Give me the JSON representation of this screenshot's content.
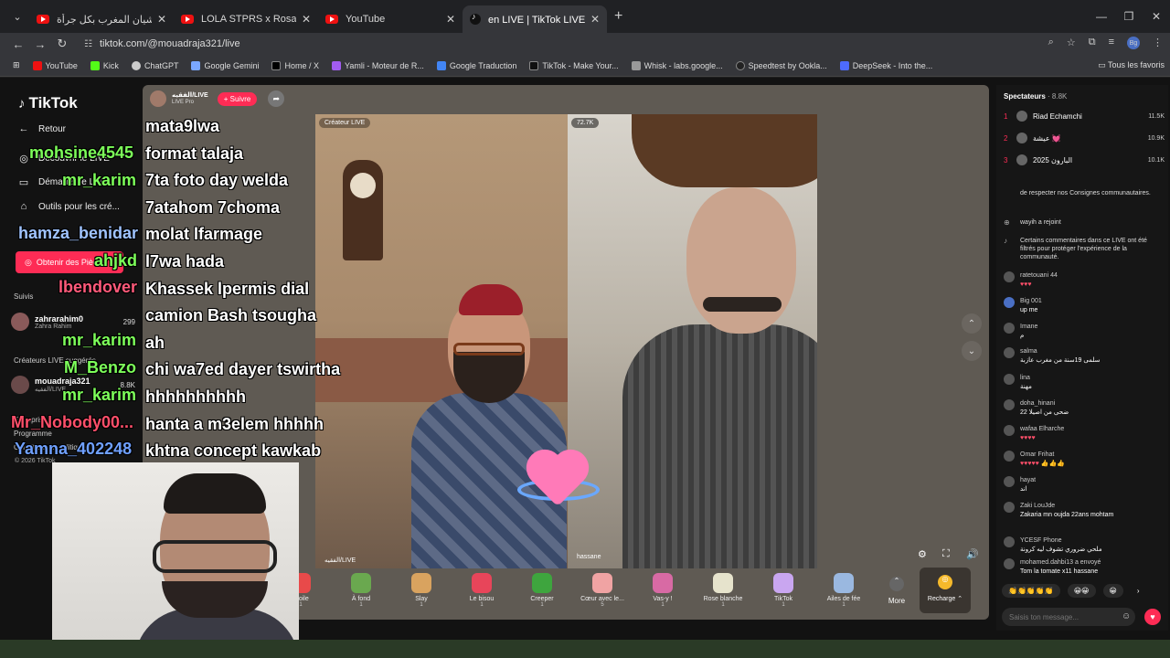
{
  "browser": {
    "tabs": [
      {
        "title": "كيم كارديشيان المغرب بكل جرأة...",
        "icon": "youtube-icon"
      },
      {
        "title": "LOLA STPRS x Rosalia BAGDAD",
        "icon": "youtube-icon"
      },
      {
        "title": "YouTube",
        "icon": "youtube-icon"
      },
      {
        "title": "en LIVE | TikTok LIVE/الفقيه",
        "icon": "tiktok-icon"
      }
    ],
    "url": "tiktok.com/@mouadraja321/live",
    "profile": "Bg",
    "bookmarks": [
      "YouTube",
      "Kick",
      "ChatGPT",
      "Google Gemini",
      "Home / X",
      "Yamli - Moteur de R...",
      "Google Traduction",
      "TikTok - Make Your...",
      "Whisk - labs.google...",
      "Speedtest by Ookla...",
      "DeepSeek - Into the..."
    ],
    "bookmarks_right": "Tous les favoris"
  },
  "sidebar": {
    "logo": "TikTok",
    "back": "Retour",
    "nav": [
      "Découvrir le LIVE",
      "Démarrer le LIVE",
      "Outils pour les cré..."
    ],
    "get_button": "Obtenir des Pièces",
    "following_label": "Suivis",
    "following": {
      "name": "zahrarahim0",
      "sub": "Zahra Rahim",
      "count": "299"
    },
    "suggested_label": "Créateurs LIVE suggérés",
    "suggested": {
      "name": "mouadraja321",
      "sub": "الفقيه/LIVE",
      "count": "8.8K"
    },
    "entreprise": "Entreprise",
    "programme": "Programme",
    "conditions": "Conditions et politiques",
    "copyright": "© 2026 TikTok"
  },
  "stream": {
    "host_name": "الفقيه/LIVE",
    "host_sub": "LIVE Pro",
    "follow": "+ Suivre",
    "creator_tag": "Créateur LIVE",
    "viewer_tag": "72.7K",
    "left_name": "الفقيه/LIVE",
    "right_name": "hassane"
  },
  "overlay_chat": [
    "mata9lwa",
    "format talaja",
    "7ta foto day welda",
    "7atahom 7choma",
    "molat lfarmage",
    "l7wa hada",
    "Khassek lpermis dial",
    "camion Bash tsougha",
    "ah",
    "chi wa7ed dayer tswirtha",
    "hhhhhhhhhh",
    "hanta a m3elem hhhhh",
    "khtna concept kawkab"
  ],
  "overlay_users": [
    {
      "name": "mohsine4545",
      "color": "#7dff5a"
    },
    {
      "name": "mr_karim",
      "color": "#7dff5a"
    },
    {
      "name": "hamza_benidar",
      "color": "#9fc3ff"
    },
    {
      "name": "ahjkd",
      "color": "#7dff5a"
    },
    {
      "name": "lbendover",
      "color": "#ff5a7a"
    },
    {
      "name": "mr_karim",
      "color": "#7dff5a"
    },
    {
      "name": "M_Benzo",
      "color": "#7dff5a"
    },
    {
      "name": "mr_karim",
      "color": "#7dff5a"
    },
    {
      "name": "Mr_Nobody00...",
      "color": "#ff4f6a"
    },
    {
      "name": "Yamna_402248",
      "color": "#6fa0ff"
    }
  ],
  "gifts": [
    {
      "name": "Étoile",
      "price": "1"
    },
    {
      "name": "À fond",
      "price": "1"
    },
    {
      "name": "Slay",
      "price": "1"
    },
    {
      "name": "Le bisou",
      "price": "1"
    },
    {
      "name": "Creeper",
      "price": "1"
    },
    {
      "name": "Cœur avec le...",
      "price": "5"
    },
    {
      "name": "Vas-y !",
      "price": "1"
    },
    {
      "name": "Rose blanche",
      "price": "1"
    },
    {
      "name": "TikTok",
      "price": "1"
    },
    {
      "name": "Ailes de fée",
      "price": "1"
    }
  ],
  "more": "More",
  "recharge": "Recharge ⌃",
  "right_panel": {
    "spectators_label": "Spectateurs",
    "spectators_count": "· 8.8K",
    "ranks": [
      {
        "n": "1",
        "name": "Riad Echamchi",
        "val": "11.5K"
      },
      {
        "n": "2",
        "name": "عيشة 💓",
        "val": "10.9K"
      },
      {
        "n": "3",
        "name": "البارون 2025",
        "val": "10.1K"
      }
    ],
    "notice": "de respecter nos Consignes communautaires.",
    "joined_user": "wayih",
    "joined_text": "a rejoint",
    "filter_notice": "Certains commentaires dans ce LIVE ont été filtrés pour protéger l'expérience de la communauté.",
    "messages": [
      {
        "name": "ratetouani 44",
        "text": "♥♥♥"
      },
      {
        "name": "Big 001",
        "text": "up me"
      },
      {
        "name": "Imane",
        "text": "م"
      },
      {
        "name": "salma",
        "text": "سلمى 19سنة من مغرب عازبة"
      },
      {
        "name": "lina",
        "text": "مهنة"
      },
      {
        "name": "doha_hinani",
        "text": "22 ضحى من اصيلا"
      },
      {
        "name": "wafaa Elharche",
        "text": "♥♥♥♥"
      },
      {
        "name": "Omar Frihat",
        "text": "♥♥♥♥♥ 👍👍👍"
      },
      {
        "name": "hayat",
        "text": "اند"
      },
      {
        "name": "Zaki LouJde",
        "text": "Zakaria mn oujda 22ans mohtam"
      },
      {
        "name": "YCESF Phone",
        "text": "ملحي ضروري تشوف ليه كرونة"
      },
      {
        "name": "mohamed.dahbi13",
        "text": "Tom la tomate x11"
      }
    ],
    "gift_sender_tail": "a envoyé",
    "gift_recipient": "hassane",
    "quick_replies": [
      "👏👏👏👏👏",
      "😀😀",
      "😀"
    ],
    "input_placeholder": "Saisis ton message..."
  }
}
